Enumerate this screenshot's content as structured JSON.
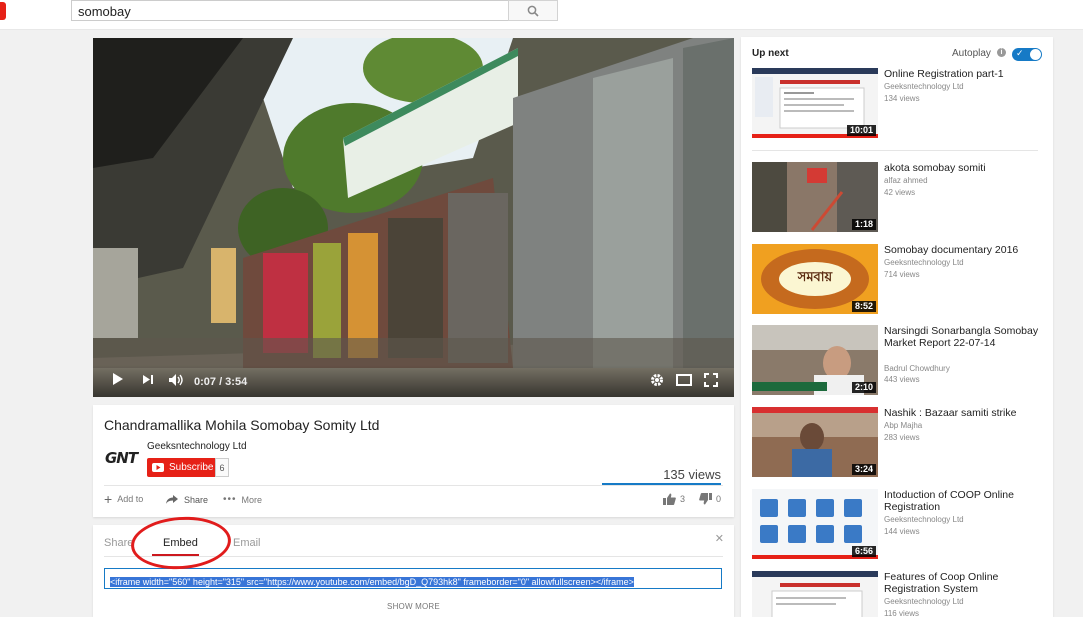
{
  "search": {
    "query": "somobay"
  },
  "player": {
    "time": "0:07 / 3:54",
    "progress": 0.03
  },
  "video": {
    "title": "Chandramallika Mohila Somobay Somity Ltd",
    "channel": "Geeksntechnology Ltd",
    "channel_logo": "GNT",
    "subscribe_label": "Subscribe",
    "subscriber_count": "6",
    "views": "135 views",
    "add_to": "Add to",
    "share": "Share",
    "more": "More",
    "likes": "3",
    "dislikes": "0"
  },
  "share_panel": {
    "tabs": [
      "Share",
      "Embed",
      "Email"
    ],
    "active_tab": "Embed",
    "embed_code": "<iframe width=\"560\" height=\"315\" src=\"https://www.youtube.com/embed/bgD_Q793hk8\" frameborder=\"0\" allowfullscreen></iframe>",
    "show_more": "SHOW MORE"
  },
  "sidebar": {
    "up_next": "Up next",
    "autoplay": "Autoplay",
    "autoplay_on": true,
    "items": [
      {
        "title": "Online Registration part-1",
        "channel": "Geeksntechnology Ltd",
        "views": "134 views",
        "duration": "10:01"
      },
      {
        "title": "akota somobay somiti",
        "channel": "alfaz ahmed",
        "views": "42 views",
        "duration": "1:18"
      },
      {
        "title": "Somobay documentary 2016",
        "channel": "Geeksntechnology Ltd",
        "views": "714 views",
        "duration": "8:52",
        "thumb_text": "সমবায়"
      },
      {
        "title": "Narsingdi Sonarbangla Somobay Market Report 22-07-14",
        "channel": "Badrul Chowdhury",
        "views": "443 views",
        "duration": "2:10"
      },
      {
        "title": "Nashik : Bazaar samiti strike",
        "channel": "Abp Majha",
        "views": "283 views",
        "duration": "3:24"
      },
      {
        "title": "Intoduction of COOP Online Registration",
        "channel": "Geeksntechnology Ltd",
        "views": "144 views",
        "duration": "6:56"
      },
      {
        "title": "Features of Coop Online Registration System",
        "channel": "Geeksntechnology Ltd",
        "views": "116 views",
        "duration": ""
      }
    ]
  },
  "colors": {
    "accent": "#167ac6",
    "red": "#e62117",
    "annotation": "#e11c1c"
  }
}
